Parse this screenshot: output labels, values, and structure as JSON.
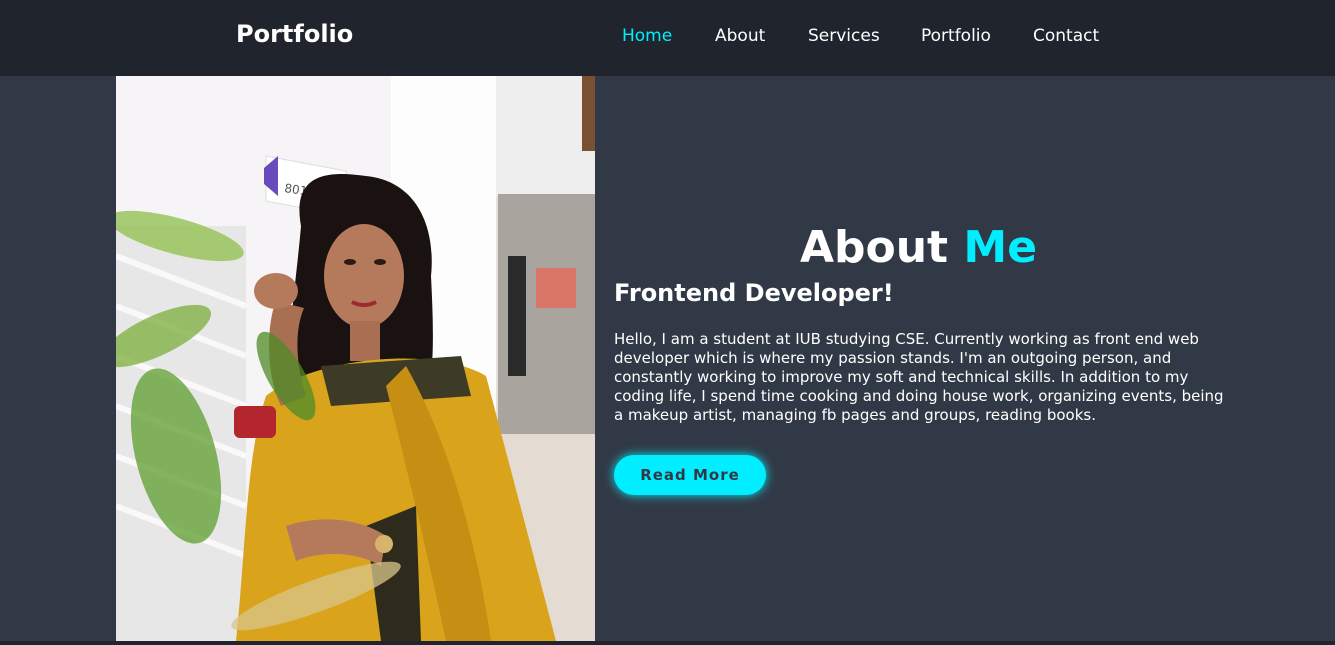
{
  "header": {
    "logo": "Portfolio",
    "nav": [
      {
        "label": "Home",
        "active": true
      },
      {
        "label": "About",
        "active": false
      },
      {
        "label": "Services",
        "active": false
      },
      {
        "label": "Portfolio",
        "active": false
      },
      {
        "label": "Contact",
        "active": false
      }
    ]
  },
  "about": {
    "heading_main": "About",
    "heading_accent": "Me",
    "subheading": "Frontend Developer!",
    "paragraph": "Hello, I am a student at IUB studying CSE. Currently working as front end web developer which is where my passion stands. I'm an outgoing person, and constantly working to improve my soft and technical skills. In addition to my coding life, I spend time cooking and doing house work, organizing events, being a makeup artist, managing fb pages and groups, reading books.",
    "button_label": "Read More",
    "photo_sign_text": "8015"
  },
  "colors": {
    "accent": "#00eeff",
    "background": "#323946",
    "header_background": "#1f242d",
    "text": "#ffffff"
  }
}
